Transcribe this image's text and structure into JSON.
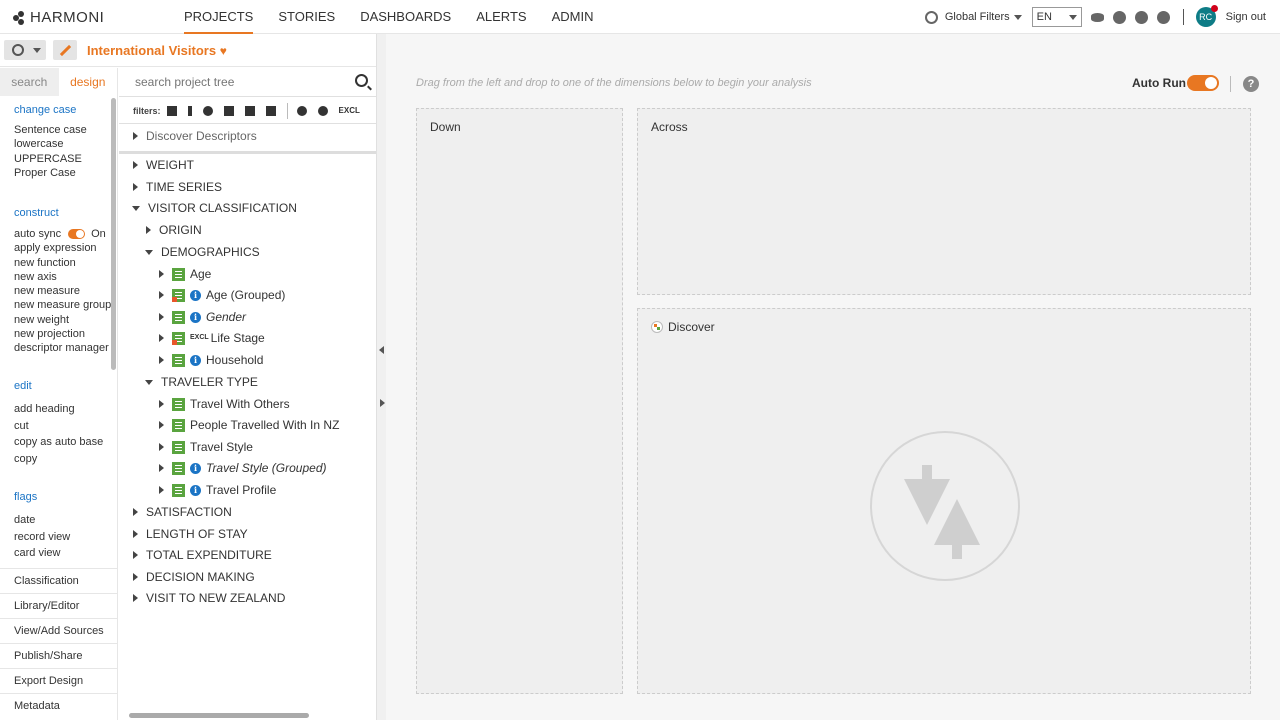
{
  "app": {
    "logo": "HARMONI"
  },
  "nav": {
    "items": [
      "PROJECTS",
      "STORIES",
      "DASHBOARDS",
      "ALERTS",
      "ADMIN"
    ],
    "active": "PROJECTS"
  },
  "topbar": {
    "global_filters": "Global Filters",
    "language": "EN",
    "avatar_initials": "RC",
    "sign_out": "Sign out"
  },
  "project": {
    "title": "International Visitors"
  },
  "left_tabs": {
    "search": "search",
    "design": "design"
  },
  "left_panel": {
    "change_case": {
      "heading": "change case",
      "items": [
        "Sentence case",
        "lowercase",
        "UPPERCASE",
        "Proper Case"
      ]
    },
    "construct": {
      "heading": "construct",
      "auto_sync_label": "auto sync",
      "auto_sync_state": "On",
      "items": [
        "apply expression",
        "new function",
        "new axis",
        "new measure",
        "new measure group",
        "new weight",
        "new projection",
        "descriptor manager"
      ]
    },
    "edit": {
      "heading": "edit",
      "items": [
        "add heading",
        "cut",
        "copy as auto base",
        "copy"
      ]
    },
    "flags": {
      "heading": "flags",
      "items": [
        "date",
        "record view",
        "card view"
      ]
    },
    "bottom_items": [
      "Classification",
      "Library/Editor",
      "View/Add Sources",
      "Publish/Share",
      "Export Design",
      "Metadata"
    ]
  },
  "tree": {
    "search_placeholder": "search project tree",
    "filters_label": "filters:",
    "excl_label": "EXCL",
    "discover": "Discover Descriptors",
    "rows": {
      "weight": "WEIGHT",
      "time_series": "TIME SERIES",
      "visitor_classification": "VISITOR CLASSIFICATION",
      "origin": "ORIGIN",
      "demographics": "DEMOGRAPHICS",
      "age": "Age",
      "age_grouped": "Age (Grouped)",
      "gender": "Gender",
      "life_stage_tag": "EXCL",
      "life_stage": "Life Stage",
      "household": "Household",
      "traveler_type": "TRAVELER TYPE",
      "travel_with_others": "Travel With Others",
      "people_travelled": "People Travelled With In NZ",
      "travel_style": "Travel Style",
      "travel_style_grouped": "Travel Style (Grouped)",
      "travel_profile": "Travel Profile",
      "satisfaction": "SATISFACTION",
      "length_of_stay": "LENGTH OF STAY",
      "total_expenditure": "TOTAL EXPENDITURE",
      "decision_making": "DECISION MAKING",
      "visit_nz": "VISIT TO NEW ZEALAND"
    }
  },
  "main": {
    "hint": "Drag from the left and drop to one of the dimensions below to begin your analysis",
    "auto_run_label": "Auto Run",
    "help": "?",
    "zones": {
      "down": "Down",
      "across": "Across",
      "discover": "Discover"
    }
  },
  "colors": {
    "accent": "#e87722",
    "link": "#1b74c5",
    "variable": "#5aa43f",
    "avatar": "#0e7c86"
  }
}
